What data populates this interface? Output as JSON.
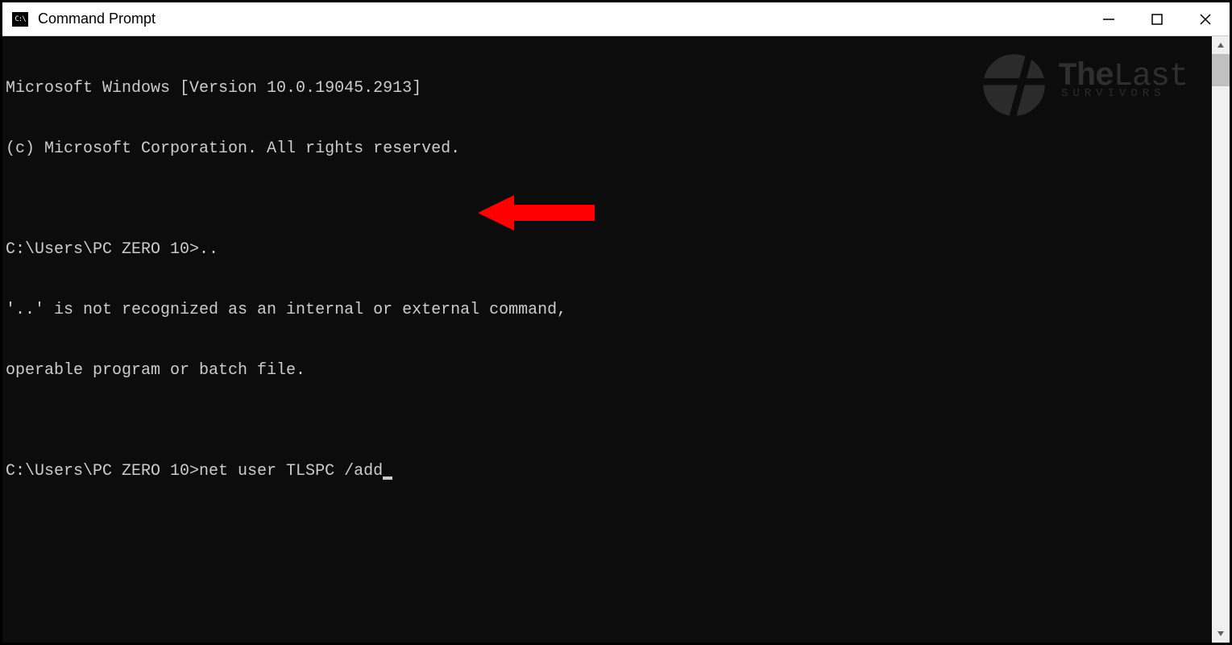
{
  "window": {
    "title": "Command Prompt",
    "icon_text": "C:\\"
  },
  "terminal": {
    "lines": [
      "Microsoft Windows [Version 10.0.19045.2913]",
      "(c) Microsoft Corporation. All rights reserved.",
      "",
      "C:\\Users\\PC ZERO 10>..",
      "'..' is not recognized as an internal or external command,",
      "operable program or batch file.",
      "",
      "C:\\Users\\PC ZERO 10>net user TLSPC /add"
    ]
  },
  "watermark": {
    "title_bold": "The",
    "title_light": "Last",
    "subtitle": "SURVIVORS"
  },
  "annotation": {
    "arrow_color": "#ff0000"
  }
}
